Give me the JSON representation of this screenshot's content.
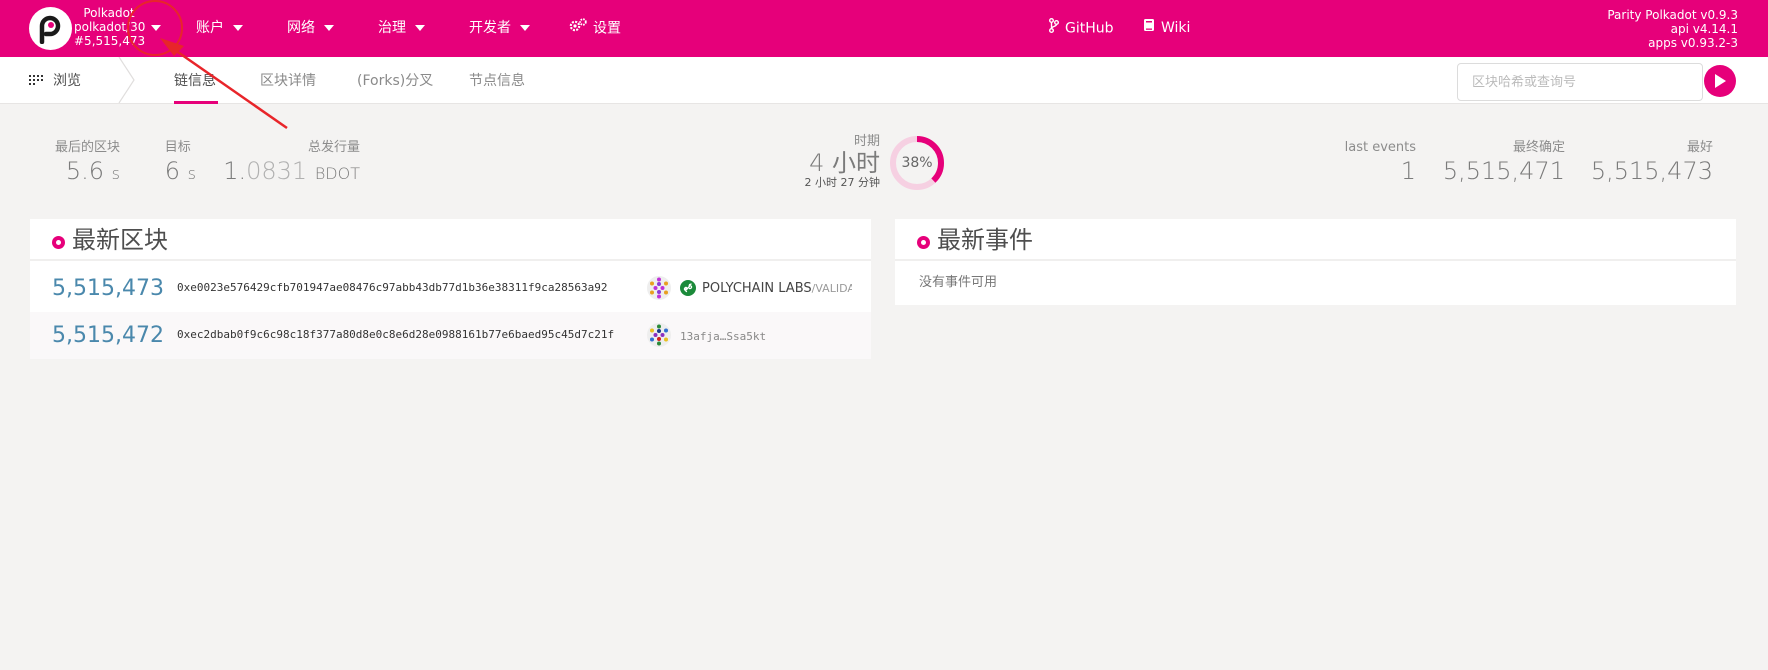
{
  "header": {
    "chain_name": "Polkadot",
    "chain_spec": "polkadot/30",
    "best_block": "#5,515,473",
    "menu": [
      {
        "label": "账户"
      },
      {
        "label": "网络"
      },
      {
        "label": "治理"
      },
      {
        "label": "开发者"
      }
    ],
    "settings_label": "设置",
    "github_label": "GitHub",
    "wiki_label": "Wiki",
    "version_node": "Parity Polkadot v0.9.3",
    "version_api": "api v4.14.1",
    "version_apps": "apps v0.93.2-3",
    "brand_color": "#e6007a"
  },
  "subnav": {
    "section": "浏览",
    "tabs": [
      {
        "label": "链信息",
        "active": true
      },
      {
        "label": "区块详情",
        "active": false
      },
      {
        "label": "(Forks)分叉",
        "active": false
      },
      {
        "label": "节点信息",
        "active": false
      }
    ],
    "search_placeholder": "区块哈希或查询号"
  },
  "summary": {
    "last_block": {
      "label": "最后的区块",
      "value": "5.6",
      "unit": "s"
    },
    "target": {
      "label": "目标",
      "value": "6",
      "unit": "s"
    },
    "total_issuance": {
      "label": "总发行量",
      "value_main": "1.",
      "value_dim": "0831",
      "unit": "BDOT"
    },
    "epoch": {
      "label": "时期",
      "value": "4 小时",
      "remaining": "2 小时 27 分钟",
      "progress_percent": 38,
      "progress_label": "38%"
    },
    "last_events": {
      "label": "last events",
      "value": "1"
    },
    "finalized": {
      "label": "最终确定",
      "value": "5,515,471"
    },
    "best": {
      "label": "最好",
      "value": "5,515,473"
    }
  },
  "recent_blocks": {
    "title": "最新区块",
    "rows": [
      {
        "number": "5,515,473",
        "hash": "0xe0023e576429cfb701947ae08476c97abb43db77d1b36e38311f9ca28563a92",
        "author_name": "POLYCHAIN LABS",
        "author_suffix": "/VALIDATOR",
        "verified": true
      },
      {
        "number": "5,515,472",
        "hash": "0xec2dbab0f9c6c98c18f377a80d8e0c8e6d28e0988161b77e6baed95c45d7c21f",
        "author_name": "13afja…Ssa5kt",
        "author_suffix": "",
        "verified": false
      }
    ]
  },
  "recent_events": {
    "title": "最新事件",
    "empty_message": "没有事件可用"
  }
}
